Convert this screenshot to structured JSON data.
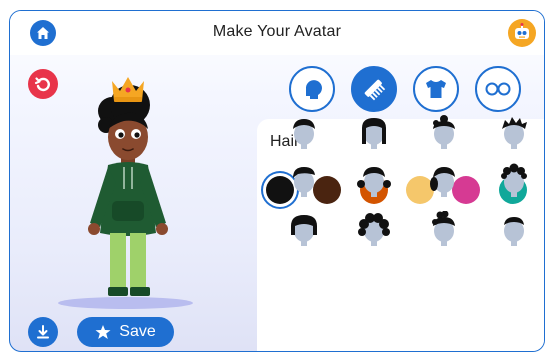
{
  "header": {
    "title": "Make Your Avatar",
    "home_icon": "home-icon",
    "profile_icon": "robot-icon"
  },
  "avatar": {
    "undo_icon": "undo-icon",
    "accessory": "crown",
    "skin_color": "#8a4a2f",
    "hair_color": "#111111",
    "top_color": "#1f5b32",
    "pants_color": "#9fd16a"
  },
  "categories": [
    {
      "name": "head",
      "icon": "head-icon",
      "active": false
    },
    {
      "name": "hair",
      "icon": "comb-icon",
      "active": true
    },
    {
      "name": "clothing",
      "icon": "shirt-icon",
      "active": false
    },
    {
      "name": "glasses",
      "icon": "glasses-icon",
      "active": false
    }
  ],
  "panel": {
    "title": "Hair",
    "colors": [
      {
        "hex": "#111111",
        "selected": true
      },
      {
        "hex": "#4a2410",
        "selected": false
      },
      {
        "hex": "#d35400",
        "selected": false
      },
      {
        "hex": "#f5c76b",
        "selected": false
      },
      {
        "hex": "#d63a93",
        "selected": false
      },
      {
        "hex": "#10a89a",
        "selected": false
      }
    ],
    "hair_styles": [
      "short-crop",
      "long-straight",
      "top-bun",
      "spiky",
      "side-part",
      "pigtails",
      "side-ponytail",
      "short-curly",
      "bob",
      "big-curly",
      "curly-bun",
      "buzz"
    ]
  },
  "footer": {
    "download_icon": "download-icon",
    "save_icon": "star-icon",
    "save_label": "Save"
  }
}
